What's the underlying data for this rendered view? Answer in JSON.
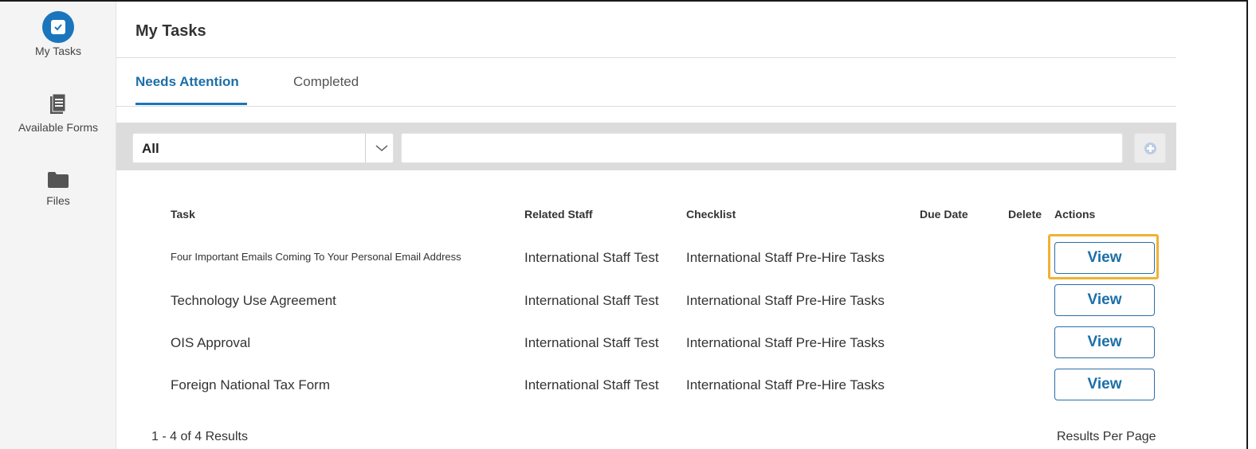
{
  "sidebar": {
    "items": [
      {
        "label": "My Tasks",
        "icon": "checkbox-icon"
      },
      {
        "label": "Available Forms",
        "icon": "document-icon"
      },
      {
        "label": "Files",
        "icon": "folder-icon"
      }
    ]
  },
  "header": {
    "title": "My Tasks"
  },
  "tabs": [
    {
      "label": "Needs Attention",
      "active": true
    },
    {
      "label": "Completed",
      "active": false
    }
  ],
  "filter": {
    "select_value": "All",
    "search_value": ""
  },
  "table": {
    "columns": [
      "Task",
      "Related Staff",
      "Checklist",
      "Due Date",
      "Delete",
      "Actions"
    ],
    "rows": [
      {
        "task": "Four Important Emails Coming To Your Personal Email Address",
        "staff": "International Staff Test",
        "checklist": "International Staff Pre-Hire Tasks",
        "due": "",
        "action": "View"
      },
      {
        "task": "Technology Use Agreement",
        "staff": "International Staff Test",
        "checklist": "International Staff Pre-Hire Tasks",
        "due": "",
        "action": "View"
      },
      {
        "task": "OIS Approval",
        "staff": "International Staff Test",
        "checklist": "International Staff Pre-Hire Tasks",
        "due": "",
        "action": "View"
      },
      {
        "task": "Foreign National Tax Form",
        "staff": "International Staff Test",
        "checklist": "International Staff Pre-Hire Tasks",
        "due": "",
        "action": "View"
      }
    ]
  },
  "footer": {
    "results_count": "1 - 4 of 4 Results",
    "results_per_page": "Results Per Page"
  },
  "colors": {
    "accent": "#1b75bc",
    "highlight": "#f0b232",
    "sidebar_bg": "#f4f4f4",
    "filter_bg": "#dcdcdc"
  }
}
